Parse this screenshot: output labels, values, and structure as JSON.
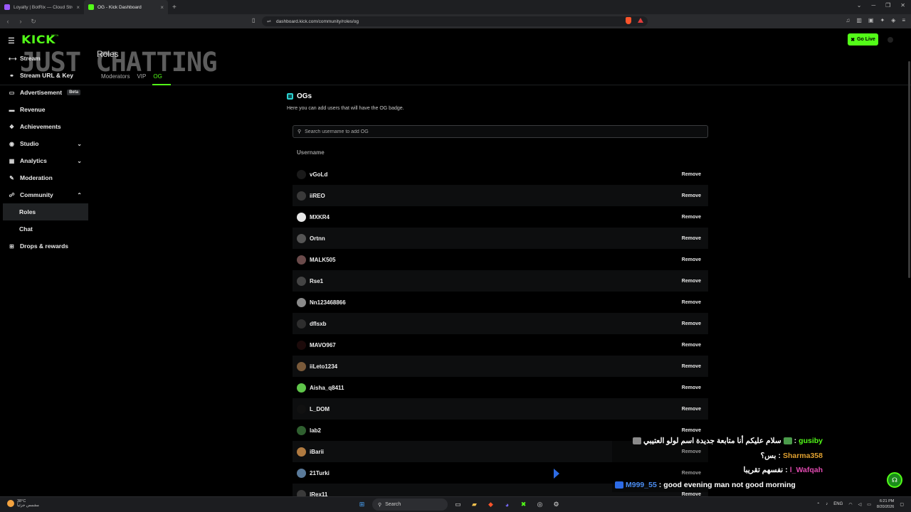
{
  "browser": {
    "tabs": [
      {
        "title": "Loyalty | BotRix — Cloud Streaming"
      },
      {
        "title": "OG - Kick Dashboard"
      }
    ],
    "url": "dashboard.kick.com/community/roles/og"
  },
  "header": {
    "logo": "KICK",
    "logo_beta": "BETA",
    "overlay_text": "JUST CHATTING",
    "page_title": "Roles",
    "subtabs": [
      "Moderators",
      "VIP",
      "OG"
    ],
    "go_live_label": "Go Live"
  },
  "sidebar": {
    "items": [
      {
        "label": "Stream",
        "icon": "stream-icon"
      },
      {
        "label": "Stream URL & Key",
        "icon": "key-icon"
      },
      {
        "label": "Advertisement",
        "icon": "advertisement-icon",
        "badge": "Beta"
      },
      {
        "label": "Revenue",
        "icon": "revenue-icon"
      },
      {
        "label": "Achievements",
        "icon": "achievements-icon"
      },
      {
        "label": "Studio",
        "icon": "studio-icon",
        "expanded": false
      },
      {
        "label": "Analytics",
        "icon": "analytics-icon",
        "expanded": false
      },
      {
        "label": "Moderation",
        "icon": "moderation-icon"
      },
      {
        "label": "Community",
        "icon": "community-icon",
        "expanded": true
      },
      {
        "label": "Roles",
        "selected": true
      },
      {
        "label": "Chat"
      },
      {
        "label": "Drops & rewards",
        "icon": "drops-icon"
      }
    ]
  },
  "main": {
    "section_title": "OGs",
    "section_description": "Here you can add users that will have the OG badge.",
    "search_placeholder": "Search username to add OG",
    "column_header": "Username",
    "remove_label": "Remove",
    "users": [
      {
        "name": "vGoLd",
        "avatar_color": "#1a1a1a"
      },
      {
        "name": "iiREO",
        "avatar_color": "#3a3a3a"
      },
      {
        "name": "MXKR4",
        "avatar_color": "#e8e8e8"
      },
      {
        "name": "Ortnn",
        "avatar_color": "#555555"
      },
      {
        "name": "MALK505",
        "avatar_color": "#6a4a4a"
      },
      {
        "name": "Rse1",
        "avatar_color": "#444444"
      },
      {
        "name": "Nn123468866",
        "avatar_color": "#8a8a8a"
      },
      {
        "name": "dflsxb",
        "avatar_color": "#2e2e2e"
      },
      {
        "name": "MAVO967",
        "avatar_color": "#1c0a0a"
      },
      {
        "name": "iiLeto1234",
        "avatar_color": "#7a5a3a"
      },
      {
        "name": "Aisha_q8411",
        "avatar_color": "#5fc54a"
      },
      {
        "name": "L_DOM",
        "avatar_color": "#111111"
      },
      {
        "name": "lab2",
        "avatar_color": "#2f5f2f"
      },
      {
        "name": "iBarii",
        "avatar_color": "#b07a40"
      },
      {
        "name": "21Turki",
        "avatar_color": "#5a7a9a"
      },
      {
        "name": "lRex11",
        "avatar_color": "#3a3a3a"
      }
    ]
  },
  "chat_overlay": {
    "messages": [
      {
        "user": "gusiby",
        "user_color": "#53fc18",
        "text": "سلام عليكم أنا متابعة جديدة اسم لولو العتيبي"
      },
      {
        "user": "Sharma358",
        "user_color": "#e0a030",
        "text": "بس؟"
      },
      {
        "user": "l_Wafqah",
        "user_color": "#e04ab0",
        "text": "نفسهم تقريبا"
      },
      {
        "user": "M999_55",
        "user_color": "#4a8cf0",
        "text": "good evening man not good morning"
      }
    ]
  },
  "taskbar": {
    "weather_temp": "38°C",
    "weather_desc": "مشمس جزئياً",
    "search_label": "Search",
    "language": "ENG",
    "time": "6:21 PM",
    "date": "8/20/2026"
  },
  "colors": {
    "accent": "#53fc18",
    "background": "#000000",
    "row_alt": "#0d0e0f"
  }
}
